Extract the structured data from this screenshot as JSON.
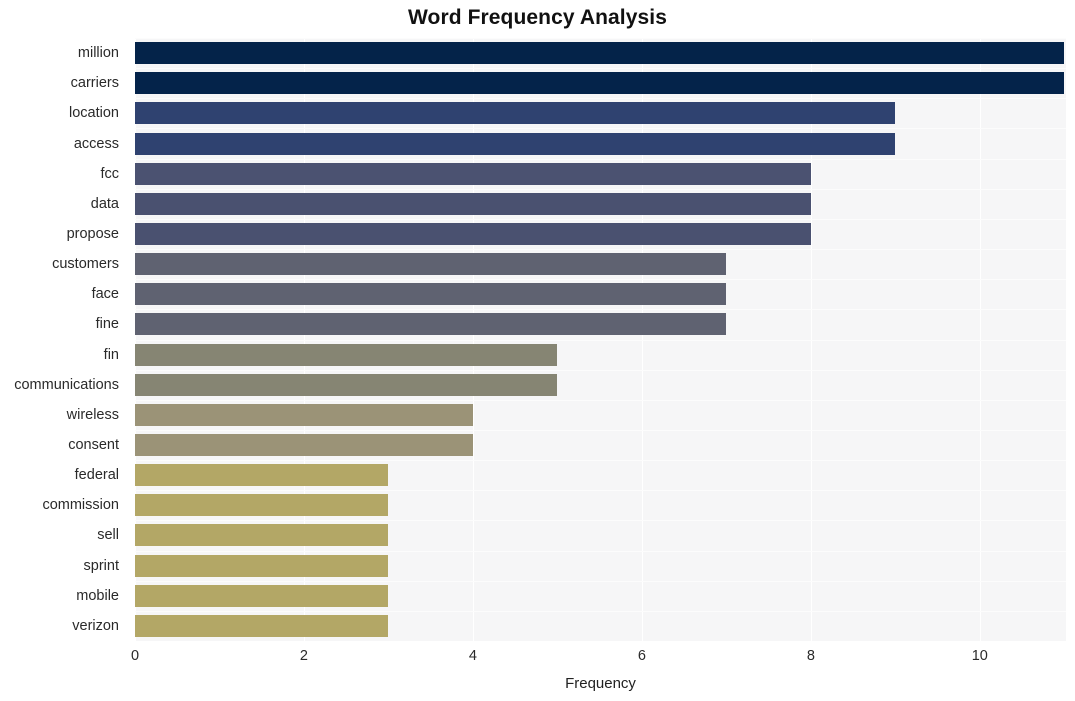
{
  "chart_data": {
    "type": "bar",
    "orientation": "horizontal",
    "title": "Word Frequency Analysis",
    "xlabel": "Frequency",
    "ylabel": "",
    "categories": [
      "million",
      "carriers",
      "location",
      "access",
      "fcc",
      "data",
      "propose",
      "customers",
      "face",
      "fine",
      "fin",
      "communications",
      "wireless",
      "consent",
      "federal",
      "commission",
      "sell",
      "sprint",
      "mobile",
      "verizon"
    ],
    "values": [
      11,
      11,
      9,
      9,
      8,
      8,
      8,
      7,
      7,
      7,
      5,
      5,
      4,
      4,
      3,
      3,
      3,
      3,
      3,
      3
    ],
    "bar_colors": [
      "#042349",
      "#04234a",
      "#2f4270",
      "#2f4270",
      "#4b5271",
      "#4a5170",
      "#4a5170",
      "#5f6271",
      "#5f6271",
      "#5f6271",
      "#868573",
      "#868573",
      "#9b9377",
      "#9b9377",
      "#b3a766",
      "#b3a766",
      "#b3a766",
      "#b3a766",
      "#b3a766",
      "#b3a766"
    ],
    "xlim": [
      0,
      11.02
    ],
    "xticks": [
      0,
      2,
      4,
      6,
      8,
      10
    ],
    "xtick_labels": [
      "0",
      "2",
      "4",
      "6",
      "8",
      "10"
    ],
    "grid": true,
    "grid_axis": "both",
    "legend": false,
    "plot_background": "#f6f6f7",
    "figure_background": "#ffffff",
    "gridline_color": "#ffffff",
    "text_color": "#2a2a2a"
  }
}
